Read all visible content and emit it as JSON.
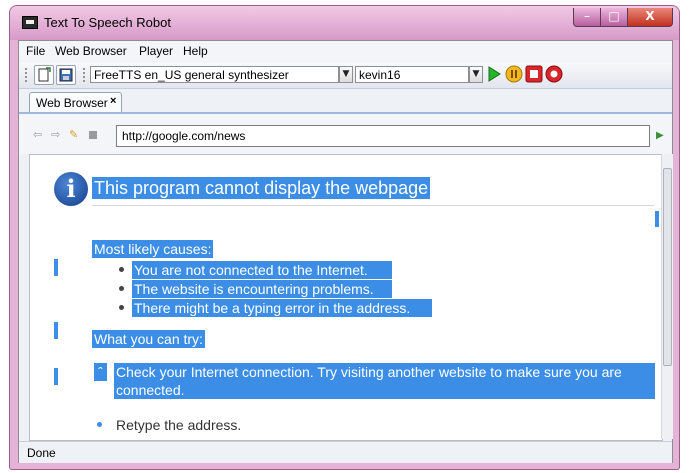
{
  "window": {
    "title": "Text To Speech Robot",
    "min_glyph": "–",
    "max_glyph": "□",
    "close_glyph": "X"
  },
  "menu": [
    "File",
    "Web Browser",
    "Player",
    "Help"
  ],
  "toolbar": {
    "synthesizer": "FreeTTS en_US general synthesizer",
    "voice": "kevin16",
    "combo_arrow": "▼"
  },
  "tab": {
    "label": "Web Browser",
    "close": "×"
  },
  "nav": {
    "url": "http://google.com/news",
    "go": "▶"
  },
  "content": {
    "info_glyph": "i",
    "heading": "This program cannot display the webpage",
    "causes_heading": "Most likely causes:",
    "causes": [
      "You are not connected to the Internet.",
      "The website is encountering problems.",
      "There might be a typing error in the address."
    ],
    "try_heading": "What you can try:",
    "try_items": [
      "Check your Internet connection. Try visiting another website to make sure you are",
      "connected.",
      "Retype the address."
    ],
    "expand_glyph": "ˆ"
  },
  "status": {
    "text": "Done"
  },
  "colors": {
    "selection": "#3b8de6",
    "window_frame": "#e6b3d8",
    "close_button": "#c2301e"
  }
}
